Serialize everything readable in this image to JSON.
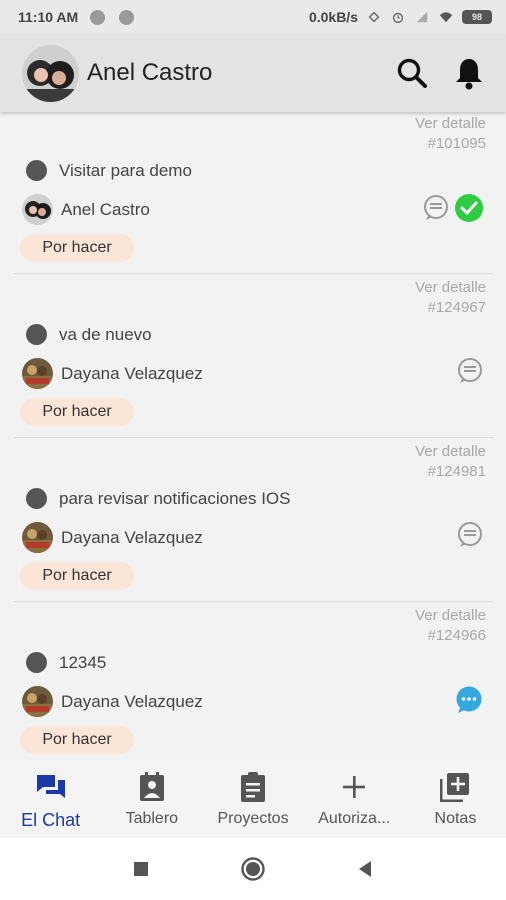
{
  "status_bar": {
    "time": "11:10 AM",
    "network_speed": "0.0kB/s",
    "battery": "98"
  },
  "header": {
    "title": "Anel Castro"
  },
  "tasks": [
    {
      "detail_label": "Ver detalle",
      "id": "#101095",
      "title": "Visitar para demo",
      "user": "Anel Castro",
      "status": "Por hacer"
    },
    {
      "detail_label": "Ver detalle",
      "id": "#124967",
      "title": "va de nuevo",
      "user": "Dayana Velazquez",
      "status": "Por hacer"
    },
    {
      "detail_label": "Ver detalle",
      "id": "#124981",
      "title": "para revisar notificaciones IOS",
      "user": "Dayana Velazquez",
      "status": "Por hacer"
    },
    {
      "detail_label": "Ver detalle",
      "id": "#124966",
      "title": "12345",
      "user": "Dayana Velazquez",
      "status": "Por hacer"
    }
  ],
  "bottom_nav": [
    {
      "label": "El Chat",
      "icon": "chat-icon",
      "active": true
    },
    {
      "label": "Tablero",
      "icon": "board-icon",
      "active": false
    },
    {
      "label": "Proyectos",
      "icon": "clipboard-icon",
      "active": false
    },
    {
      "label": "Autoriza...",
      "icon": "plus-icon",
      "active": false
    },
    {
      "label": "Notas",
      "icon": "add-note-icon",
      "active": false
    }
  ],
  "colors": {
    "accent": "#1d39a8",
    "badge_bg": "#fbe5d6",
    "check_green": "#2ecc40",
    "chat_blue": "#35a8e0"
  }
}
